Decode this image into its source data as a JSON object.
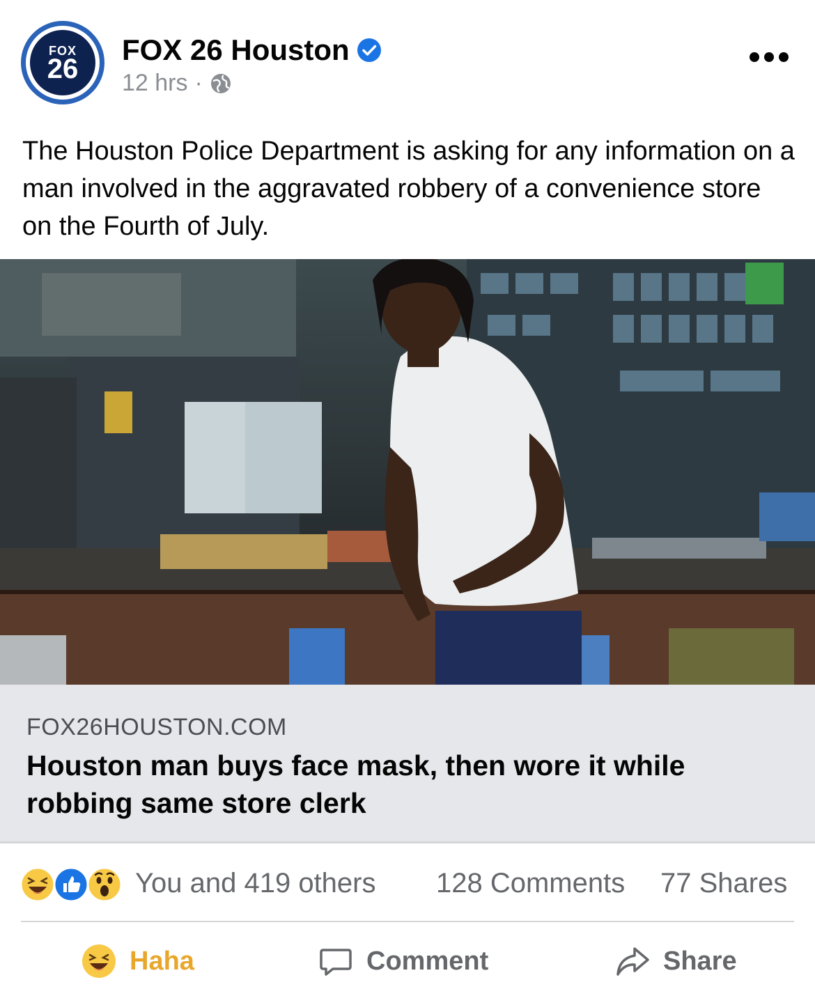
{
  "post": {
    "page_name": "FOX 26 Houston",
    "avatar": {
      "line1": "FOX",
      "line2": "26"
    },
    "time": "12 hrs",
    "separator": "·",
    "privacy_icon": "globe-icon",
    "verified_icon": "verified-badge-icon",
    "more_icon": "more-options-icon",
    "text": "The Houston Police Department is asking for any information on a man involved in the aggravated robbery of a convenience store on the Fourth of July."
  },
  "link_preview": {
    "domain": "FOX26HOUSTON.COM",
    "title": "Houston man buys face mask, then wore it while robbing same store clerk",
    "image_description_icon": "news-photo"
  },
  "engagement": {
    "reaction_icons": [
      "haha-icon",
      "like-icon",
      "wow-icon"
    ],
    "reactions_text": "You and 419 others",
    "comments_text": "128 Comments",
    "shares_text": "77 Shares"
  },
  "actions": {
    "react_label": "Haha",
    "comment_label": "Comment",
    "share_label": "Share"
  },
  "colors": {
    "accent_blue": "#1b74e4",
    "haha_yellow": "#e8a72b",
    "secondary_text": "#65676b",
    "link_bg": "#e5e7eb"
  }
}
